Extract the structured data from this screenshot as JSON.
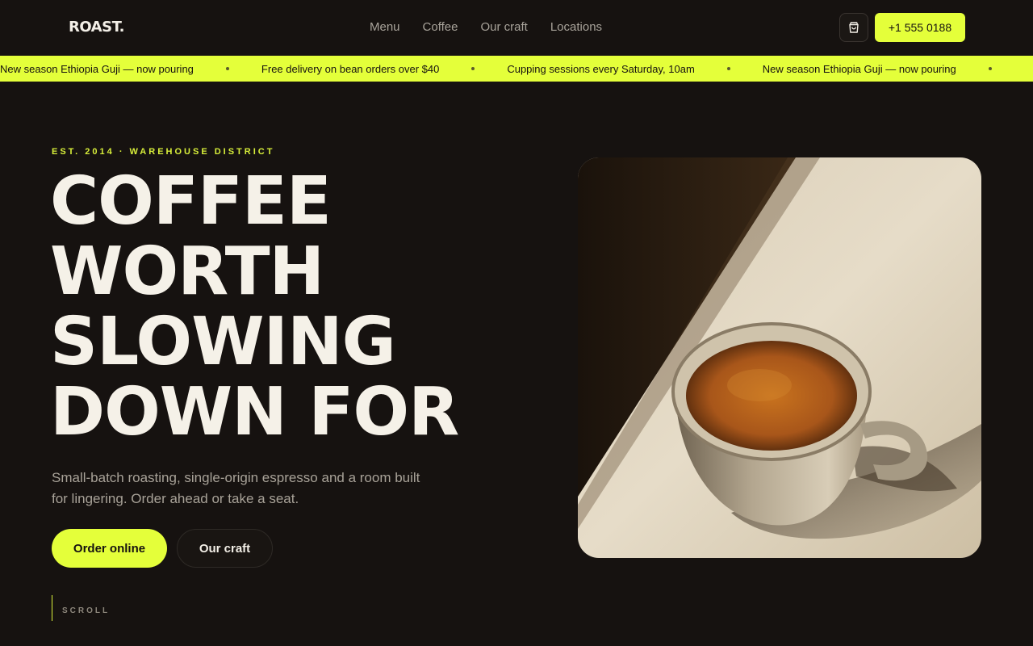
{
  "header": {
    "logo": "ROAST.",
    "nav": [
      "Menu",
      "Coffee",
      "Our craft",
      "Locations"
    ],
    "cart_icon": "shopping-bag-icon",
    "phone": "+1 555 0188"
  },
  "ticker": {
    "items": [
      "New season Ethiopia Guji — now pouring",
      "Free delivery on bean orders over $40",
      "Cupping sessions every Saturday, 10am",
      "New season Ethiopia Guji — now pouring"
    ]
  },
  "hero": {
    "eyebrow": "EST. 2014 · WAREHOUSE DISTRICT",
    "headline": [
      "COFFEE",
      "WORTH",
      "SLOWING",
      "DOWN FOR"
    ],
    "lede": "Small-batch roasting, single-origin espresso and a room built for lingering. Order ahead or take a seat.",
    "primary_cta": "Order online",
    "secondary_cta": "Our craft",
    "scroll_label": "SCROLL"
  },
  "colors": {
    "background": "#161210",
    "accent": "#e4ff3a",
    "text": "#f3efe7",
    "muted": "#a8a298"
  }
}
